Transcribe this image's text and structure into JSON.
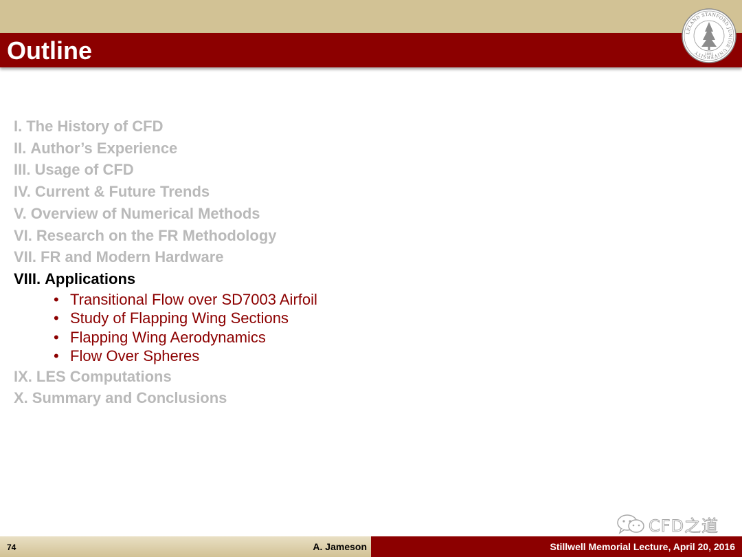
{
  "title": "Outline",
  "seal": {
    "name": "Stanford University seal",
    "text": "LELAND STANFORD JUNIOR UNIVERSITY",
    "year": "1891"
  },
  "outline": {
    "items": [
      {
        "num": "I.",
        "label": "The History of CFD",
        "active": false
      },
      {
        "num": "II.",
        "label": "Author’s Experience",
        "active": false
      },
      {
        "num": "III.",
        "label": "Usage of CFD",
        "active": false
      },
      {
        "num": "IV.",
        "label": "Current & Future Trends",
        "active": false
      },
      {
        "num": "V.",
        "label": "Overview of Numerical Methods",
        "active": false
      },
      {
        "num": "VI.",
        "label": "Research on the FR Methodology",
        "active": false
      },
      {
        "num": "VII.",
        "label": "FR and Modern Hardware",
        "active": false
      },
      {
        "num": "VIII.",
        "label": "Applications",
        "active": true
      },
      {
        "num": "IX.",
        "label": "LES Computations",
        "active": false
      },
      {
        "num": "X.",
        "label": "Summary and Conclusions",
        "active": false
      }
    ],
    "subitems": [
      "Transitional Flow over SD7003 Airfoil",
      "Study of Flapping Wing Sections",
      "Flapping Wing Aerodynamics",
      "Flow Over Spheres"
    ],
    "bullet": "•"
  },
  "footer": {
    "page_number": "74",
    "author": "A. Jameson",
    "lecture": "Stillwell Memorial Lecture, April 20, 2016"
  },
  "watermark": {
    "icon": "wechat-icon",
    "text": "CFD之道"
  },
  "colors": {
    "tan": "#d2c295",
    "cardinal": "#8c0000",
    "inactive": "#b9b9b9",
    "active": "#000000"
  }
}
